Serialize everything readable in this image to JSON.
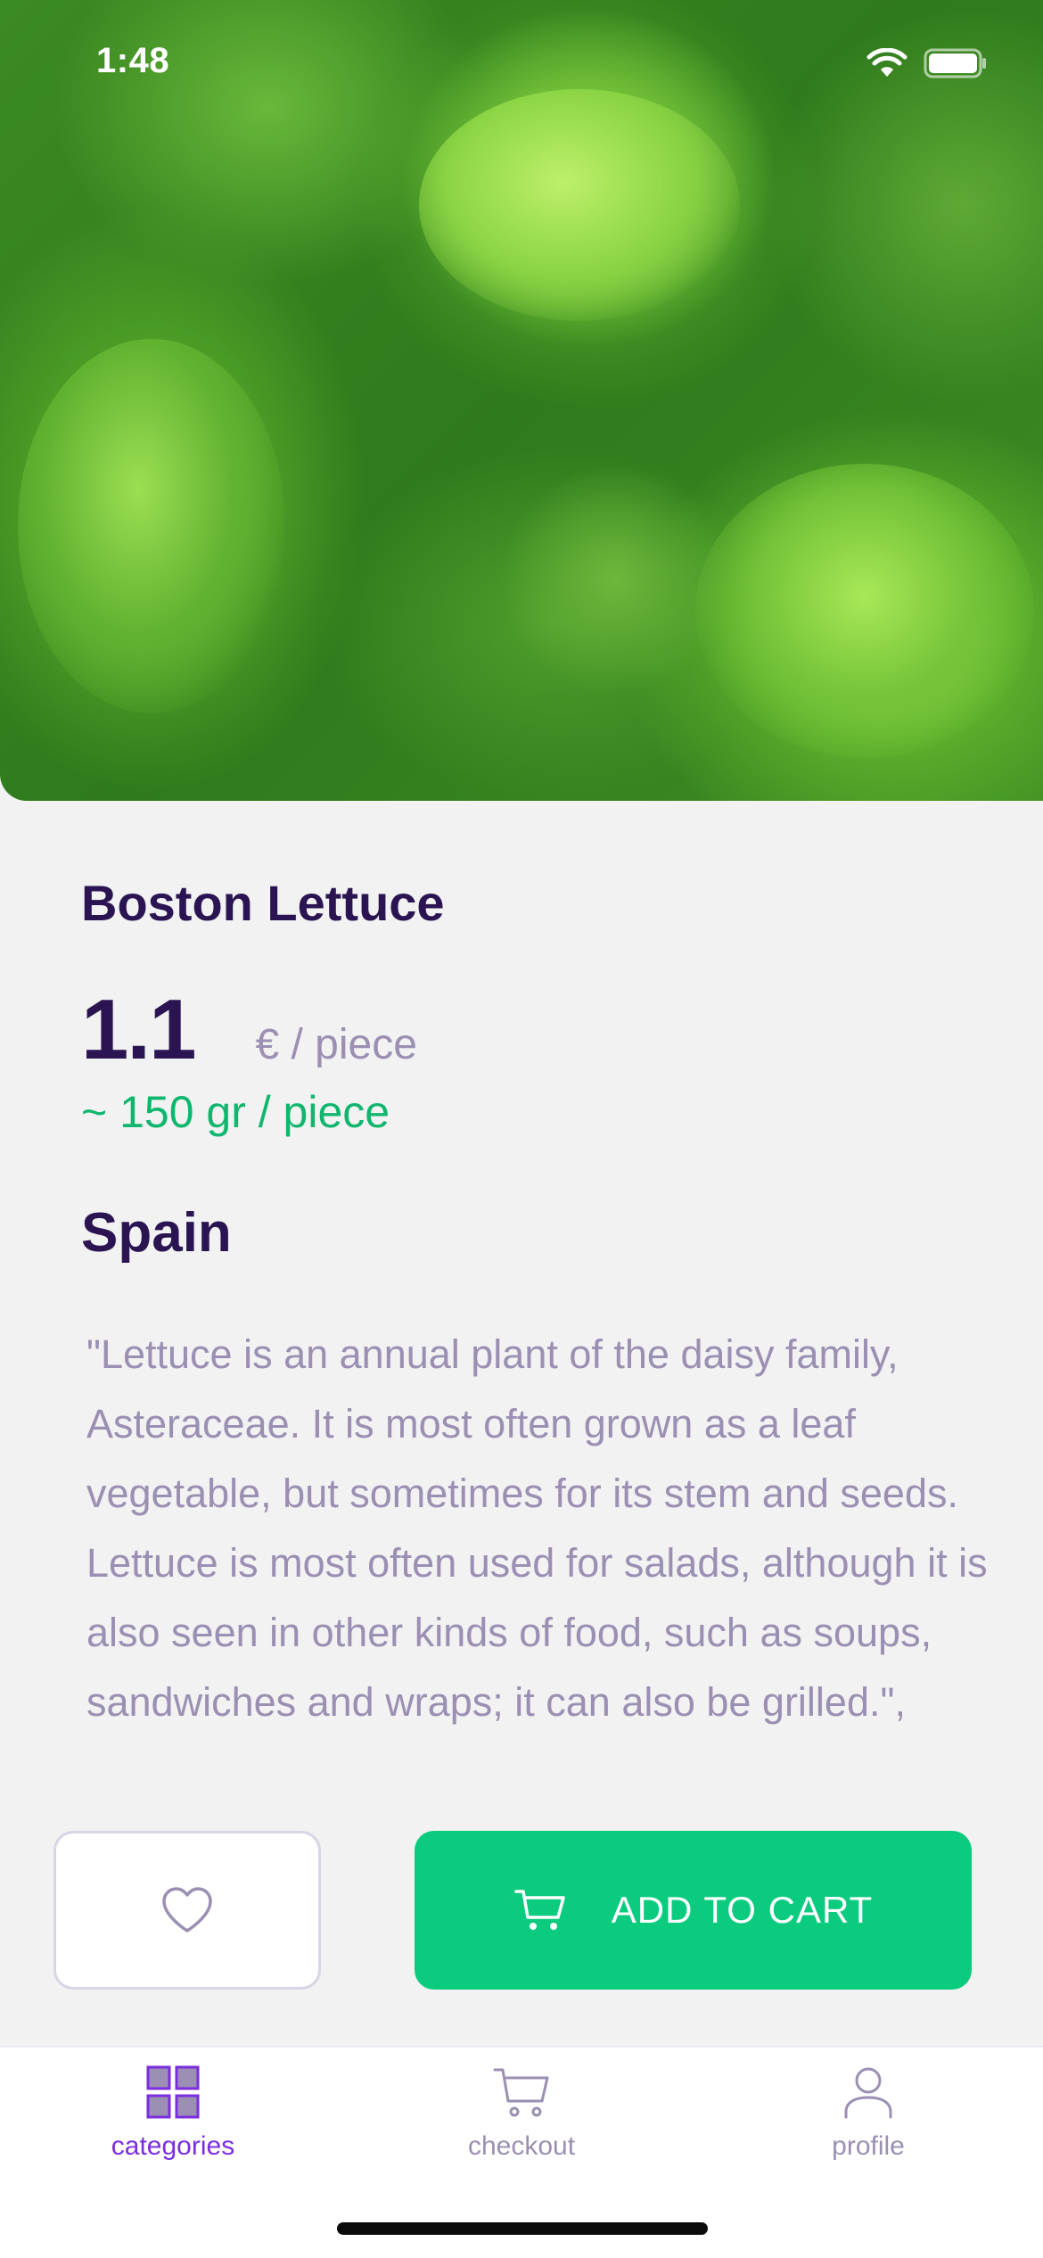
{
  "status_bar": {
    "time": "1:48"
  },
  "product": {
    "name": "Boston Lettuce",
    "price": "1.1",
    "unit": "€ / piece",
    "weight": "~ 150 gr / piece",
    "origin": "Spain",
    "description": "\"Lettuce is an annual plant of the daisy family, Asteraceae. It is most often grown as a leaf vegetable, but sometimes for its stem and seeds. Lettuce is most often used for salads, although it is also seen in other kinds of food, such as soups, sandwiches and wraps; it can also be grilled.\","
  },
  "actions": {
    "favorite_icon": "heart-icon",
    "add_to_cart_label": "ADD TO CART",
    "add_to_cart_icon": "cart-icon"
  },
  "tabbar": {
    "items": [
      {
        "label": "categories",
        "icon": "grid-icon",
        "active": true
      },
      {
        "label": "checkout",
        "icon": "cart-icon",
        "active": false
      },
      {
        "label": "profile",
        "icon": "user-icon",
        "active": false
      }
    ]
  },
  "colors": {
    "primary_text": "#2a1552",
    "muted_text": "#9b8fb3",
    "accent_green": "#0bcb7f",
    "accent_purple": "#7b2ee0",
    "background": "#f2f2f2"
  }
}
